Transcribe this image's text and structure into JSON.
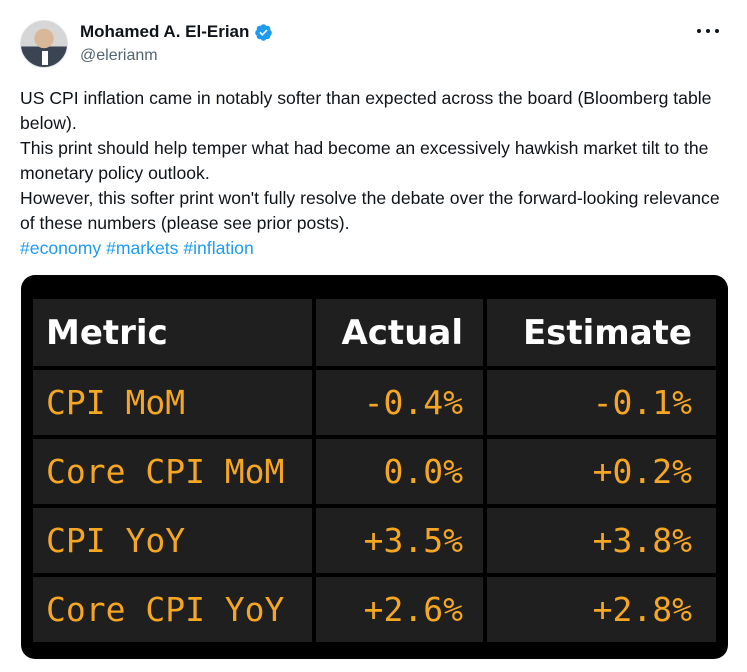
{
  "author": {
    "name": "Mohamed A. El-Erian",
    "handle": "@elerianm",
    "verified_icon": "verified-badge-icon",
    "verified_color": "#1d9bf0"
  },
  "menu": {
    "icon": "more-horizontal-icon"
  },
  "tweet": {
    "line1": "US CPI inflation came in notably softer than expected across the board (Bloomberg table below).",
    "line2": "This print should help temper what had become an excessively hawkish market tilt to the monetary policy outlook.",
    "line3": "However, this softer print won't fully resolve the debate over the forward-looking relevance of these numbers (please see prior posts).",
    "hashtags": [
      "#economy",
      "#markets",
      "#inflation"
    ]
  },
  "table": {
    "headers": [
      "Metric",
      "Actual",
      "Estimate"
    ],
    "rows": [
      [
        "CPI MoM",
        "-0.4%",
        "-0.1%"
      ],
      [
        "Core CPI MoM",
        "0.0%",
        "+0.2%"
      ],
      [
        "CPI YoY",
        "+3.5%",
        "+3.8%"
      ],
      [
        "Core CPI YoY",
        "+2.6%",
        "+2.8%"
      ]
    ],
    "value_color": "#f5a623",
    "header_color": "#ffffff"
  }
}
